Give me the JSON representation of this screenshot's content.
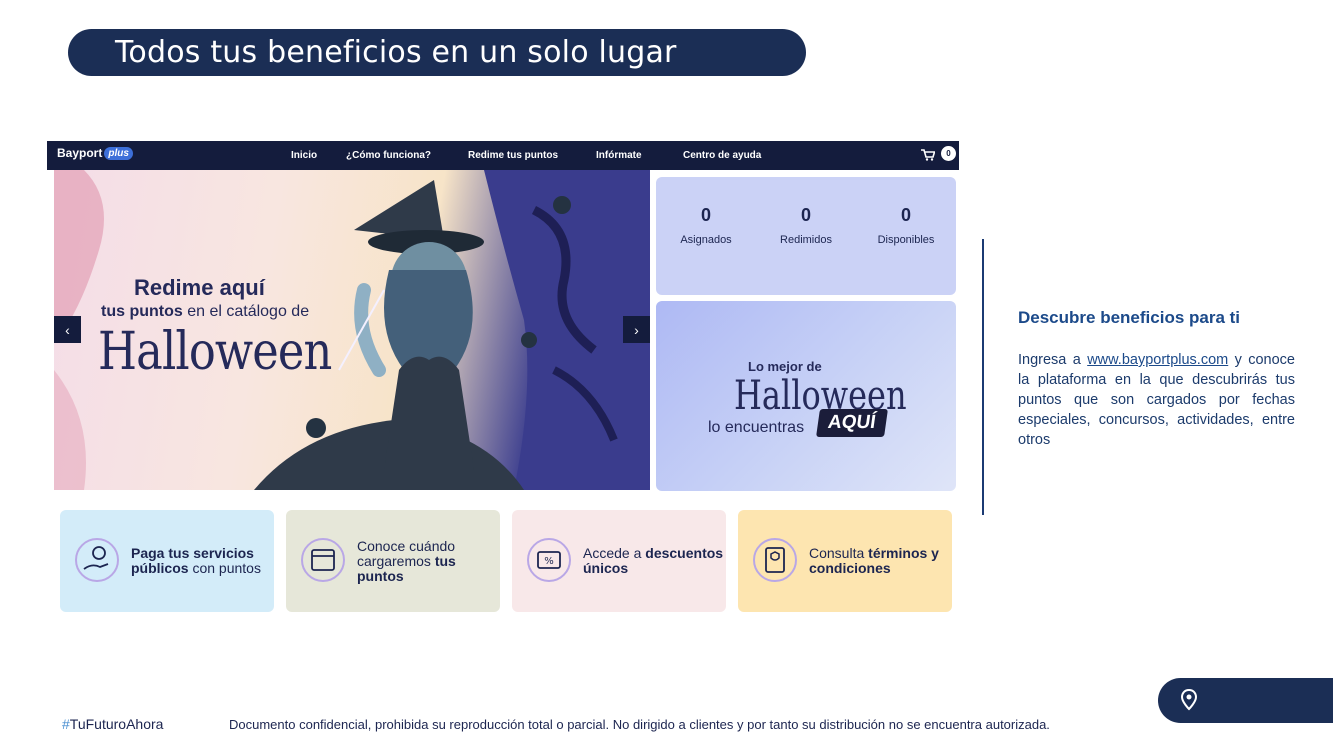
{
  "header": {
    "title": "Todos tus beneficios en un solo lugar"
  },
  "screenshot": {
    "nav": {
      "logo": "Bayport",
      "logo_badge": "plus",
      "links": [
        "Inicio",
        "¿Cómo funciona?",
        "Redime tus puntos",
        "Infórmate",
        "Centro de ayuda"
      ],
      "cart_count": "0"
    },
    "hero": {
      "line1": "Redime aquí",
      "line2_bold": "tus puntos",
      "line2_rest": " en el catálogo de",
      "line3": "Halloween",
      "prev_label": "‹",
      "next_label": "›"
    },
    "stats": [
      {
        "num": "0",
        "label": "Asignados"
      },
      {
        "num": "0",
        "label": "Redimidos"
      },
      {
        "num": "0",
        "label": "Disponibles"
      }
    ],
    "promo": {
      "l1": "Lo mejor de",
      "l2": "Halloween",
      "l3": "lo encuentras",
      "cta": "AQUÍ"
    },
    "cards": [
      {
        "bold": "Paga tus servicios públicos",
        "rest": " con puntos",
        "bg": "#d3ecf9"
      },
      {
        "pre": "Conoce cuándo cargaremos ",
        "bold": "tus puntos",
        "bg": "#e6e7d9"
      },
      {
        "pre": "Accede a ",
        "bold": "descuentos únicos",
        "bg": "#f8e8e9"
      },
      {
        "pre": "Consulta ",
        "bold": "términos y condiciones",
        "bg": "#fde5b0"
      }
    ]
  },
  "side": {
    "heading": "Descubre beneficios para ti",
    "body_pre": "Ingresa a ",
    "link": "www.bayportplus.com",
    "body_post": " y conoce la plataforma en la que descubrirás tus puntos que son cargados por fechas especiales, concursos, actividades, entre otros"
  },
  "footer": {
    "hash": "#",
    "tag": "TuFuturoAhora",
    "legal": "Documento confidencial, prohibida su reproducción  total o parcial. No dirigido a clientes y por tanto su distribución no se encuentra autorizada."
  },
  "colors": {
    "navy": "#1b2e55",
    "accent": "#4a8fd1"
  }
}
